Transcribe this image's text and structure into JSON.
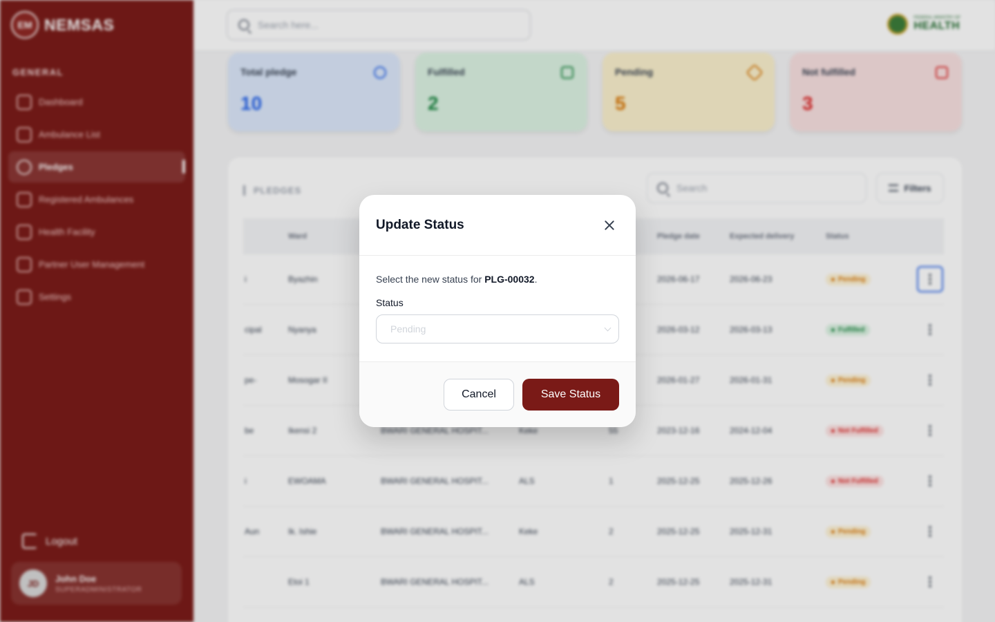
{
  "app": {
    "name": "NEMSAS",
    "logo_mark": "EM"
  },
  "sidebar": {
    "section_title": "GENERAL",
    "items": [
      {
        "label": "Dashboard",
        "icon": "grid-icon"
      },
      {
        "label": "Ambulance List",
        "icon": "list-icon"
      },
      {
        "label": "Pledges",
        "icon": "check-circle-icon",
        "active": true
      },
      {
        "label": "Registered Ambulances",
        "icon": "ambulance-icon"
      },
      {
        "label": "Health Facility",
        "icon": "hospital-icon"
      },
      {
        "label": "Partner User Management",
        "icon": "users-icon"
      },
      {
        "label": "Settings",
        "icon": "gear-icon"
      }
    ],
    "logout_label": "Logout",
    "user": {
      "initials": "JD",
      "name": "John Doe",
      "role": "SUPERADMINISTRATOR"
    }
  },
  "topbar": {
    "search_placeholder": "Search here...",
    "brand_small": "FEDERAL MINISTRY OF",
    "brand_text": "HEALTH"
  },
  "stats": [
    {
      "label": "Total pledge",
      "value": "10"
    },
    {
      "label": "Fulfilled",
      "value": "2"
    },
    {
      "label": "Pending",
      "value": "5"
    },
    {
      "label": "Not fulfilled",
      "value": "3"
    }
  ],
  "pledges": {
    "title": "PLEDGES",
    "search_placeholder": "Search",
    "filters_label": "Filters",
    "columns": [
      "",
      "Ward",
      "",
      "",
      "",
      "Pledge date",
      "Expected delivery",
      "Status"
    ],
    "rows": [
      {
        "a": "i",
        "ward": "Byazhin",
        "facility": "",
        "type": "",
        "qty": "",
        "pledge_date": "2026-06-17",
        "expected": "2026-06-23",
        "status": "Pending"
      },
      {
        "a": "cipal",
        "ward": "Nyanya",
        "facility": "",
        "type": "",
        "qty": "",
        "pledge_date": "2026-03-12",
        "expected": "2026-03-13",
        "status": "Fulfilled"
      },
      {
        "a": "pe-",
        "ward": "Mosogar II",
        "facility": "",
        "type": "",
        "qty": "",
        "pledge_date": "2026-01-27",
        "expected": "2026-01-31",
        "status": "Pending"
      },
      {
        "a": "be",
        "ward": "Ikensi 2",
        "facility": "BWARI GENERAL HOSPIT...",
        "type": "Keke",
        "qty": "55",
        "pledge_date": "2023-12-16",
        "expected": "2024-12-04",
        "status": "Not Fulfilled"
      },
      {
        "a": "i",
        "ward": "EWOAMA",
        "facility": "BWARI GENERAL HOSPIT...",
        "type": "ALS",
        "qty": "1",
        "pledge_date": "2025-12-25",
        "expected": "2025-12-26",
        "status": "Not Fulfilled"
      },
      {
        "a": "Aun",
        "ward": "Ik. Ishie",
        "facility": "BWARI GENERAL HOSPIT...",
        "type": "Keke",
        "qty": "2",
        "pledge_date": "2025-12-25",
        "expected": "2025-12-31",
        "status": "Pending"
      },
      {
        "a": "",
        "ward": "Etoi 1",
        "facility": "BWARI GENERAL HOSPIT...",
        "type": "ALS",
        "qty": "2",
        "pledge_date": "2025-12-25",
        "expected": "2025-12-31",
        "status": "Pending"
      }
    ]
  },
  "modal": {
    "title": "Update Status",
    "desc_prefix": "Select the new status for ",
    "pledge_id": "PLG-00032",
    "desc_suffix": ".",
    "field_label": "Status",
    "select_value": "Pending",
    "cancel_label": "Cancel",
    "save_label": "Save Status"
  },
  "colors": {
    "brand": "#7a1a17",
    "pending": "#d97706",
    "fulfilled": "#16843d",
    "not_fulfilled": "#dc2626",
    "total": "#2563eb"
  }
}
